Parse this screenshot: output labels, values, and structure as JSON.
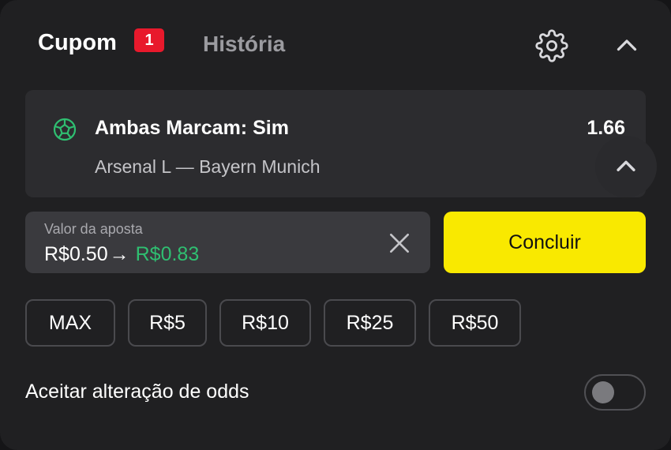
{
  "header": {
    "tab_cupom": "Cupom",
    "cupom_badge": "1",
    "tab_historia": "História"
  },
  "bet": {
    "market": "Ambas Marcam: Sim",
    "odds": "1.66",
    "event": "Arsenal L — Bayern Munich",
    "icon": "soccer-ball-icon"
  },
  "stake": {
    "label": "Valor da aposta",
    "amount": "R$0.50",
    "arrow": "→",
    "payout": "R$0.83"
  },
  "actions": {
    "concluir_label": "Concluir"
  },
  "quick_stakes": [
    "MAX",
    "R$5",
    "R$10",
    "R$25",
    "R$50"
  ],
  "settings": {
    "accept_odds_label": "Aceitar alteração de odds",
    "accept_odds_enabled": false
  },
  "colors": {
    "panel": "#202022",
    "card": "#2c2c2f",
    "accent_yellow": "#f9e900",
    "badge_red": "#e8192c",
    "payout_green": "#2fbf71"
  }
}
